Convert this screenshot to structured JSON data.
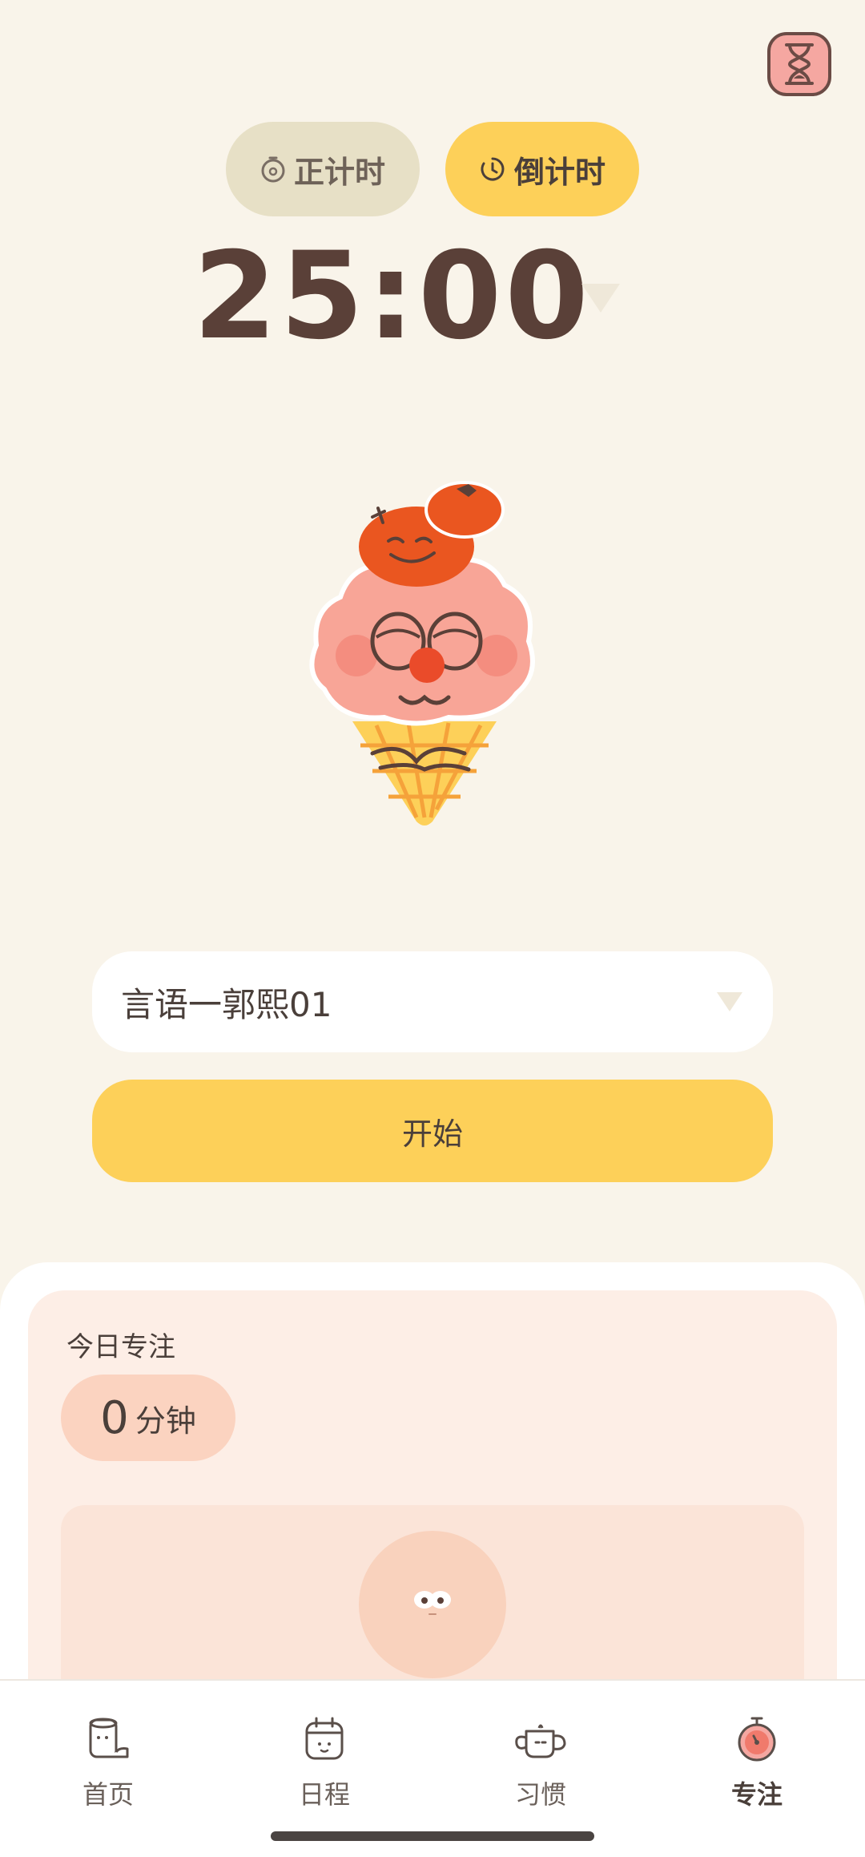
{
  "modes": {
    "count_up_label": "正计时",
    "count_down_label": "倒计时",
    "active": "count_down"
  },
  "timer": {
    "display": "25:00"
  },
  "task": {
    "selected": "言语一郭熙01"
  },
  "start_button": {
    "label": "开始"
  },
  "today": {
    "label": "今日专注",
    "value": "0",
    "unit": "分钟"
  },
  "nav": {
    "items": [
      {
        "label": "首页",
        "icon": "toilet-paper-icon"
      },
      {
        "label": "日程",
        "icon": "calendar-icon"
      },
      {
        "label": "习惯",
        "icon": "teapot-icon"
      },
      {
        "label": "专注",
        "icon": "stopwatch-icon",
        "active": true
      }
    ]
  },
  "colors": {
    "background": "#f9f4ea",
    "accent_yellow": "#fdd059",
    "inactive_pill": "#e7e0c6",
    "panel_pink": "#fdeee6",
    "timer_text": "#5a4038"
  }
}
